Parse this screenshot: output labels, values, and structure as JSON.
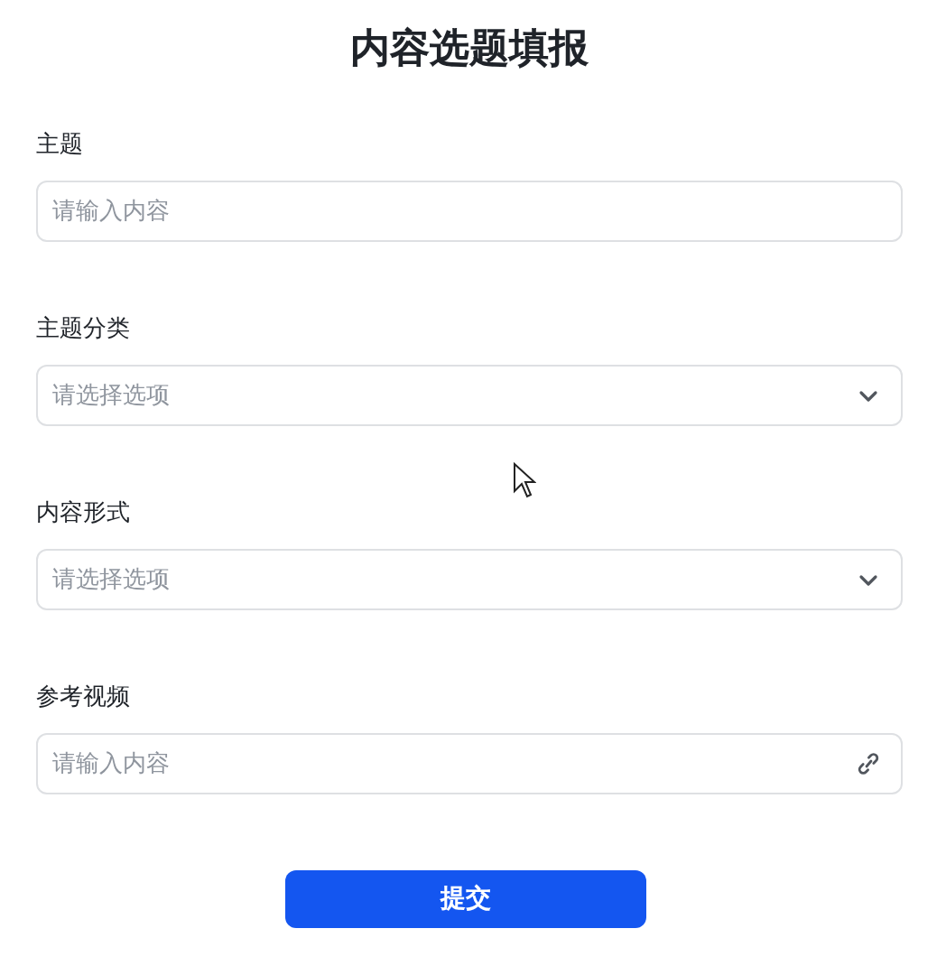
{
  "title": "内容选题填报",
  "fields": [
    {
      "label": "主题",
      "kind": "text",
      "placeholder": "请输入内容"
    },
    {
      "label": "主题分类",
      "kind": "select",
      "placeholder": "请选择选项"
    },
    {
      "label": "内容形式",
      "kind": "select",
      "placeholder": "请选择选项"
    },
    {
      "label": "参考视频",
      "kind": "link",
      "placeholder": "请输入内容"
    }
  ],
  "submit": "提交"
}
